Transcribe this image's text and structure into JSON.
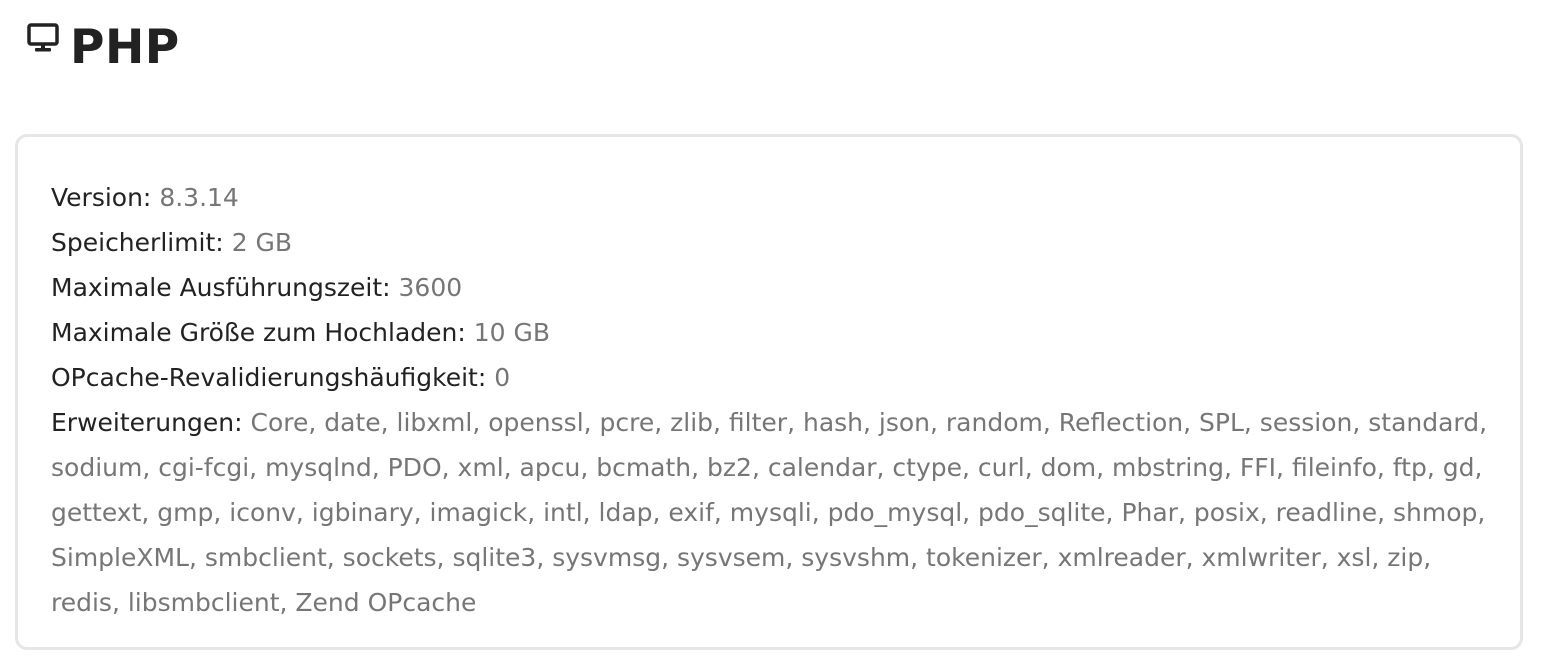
{
  "header": {
    "title": "PHP",
    "icon": "monitor-icon"
  },
  "php_info": {
    "version": {
      "label": "Version:",
      "value": "8.3.14"
    },
    "memory_limit": {
      "label": "Speicherlimit:",
      "value": "2 GB"
    },
    "max_execution_time": {
      "label": "Maximale Ausführungszeit:",
      "value": "3600"
    },
    "max_upload_size": {
      "label": "Maximale Größe zum Hochladen:",
      "value": "10 GB"
    },
    "opcache_revalidate_freq": {
      "label": "OPcache-Revalidierungshäufigkeit:",
      "value": "0"
    },
    "extensions": {
      "label": "Erweiterungen:",
      "value": "Core, date, libxml, openssl, pcre, zlib, filter, hash, json, random, Reflection, SPL, session, standard, sodium, cgi-fcgi, mysqlnd, PDO, xml, apcu, bcmath, bz2, calendar, ctype, curl, dom, mbstring, FFI, fileinfo, ftp, gd, gettext, gmp, iconv, igbinary, imagick, intl, ldap, exif, mysqli, pdo_mysql, pdo_sqlite, Phar, posix, readline, shmop, SimpleXML, smbclient, sockets, sqlite3, sysvmsg, sysvsem, sysvshm, tokenizer, xmlreader, xmlwriter, xsl, zip, redis, libsmbclient, Zend OPcache"
    }
  },
  "colors": {
    "label": "#222222",
    "value": "#767676",
    "card_border": "#e6e6e6"
  }
}
